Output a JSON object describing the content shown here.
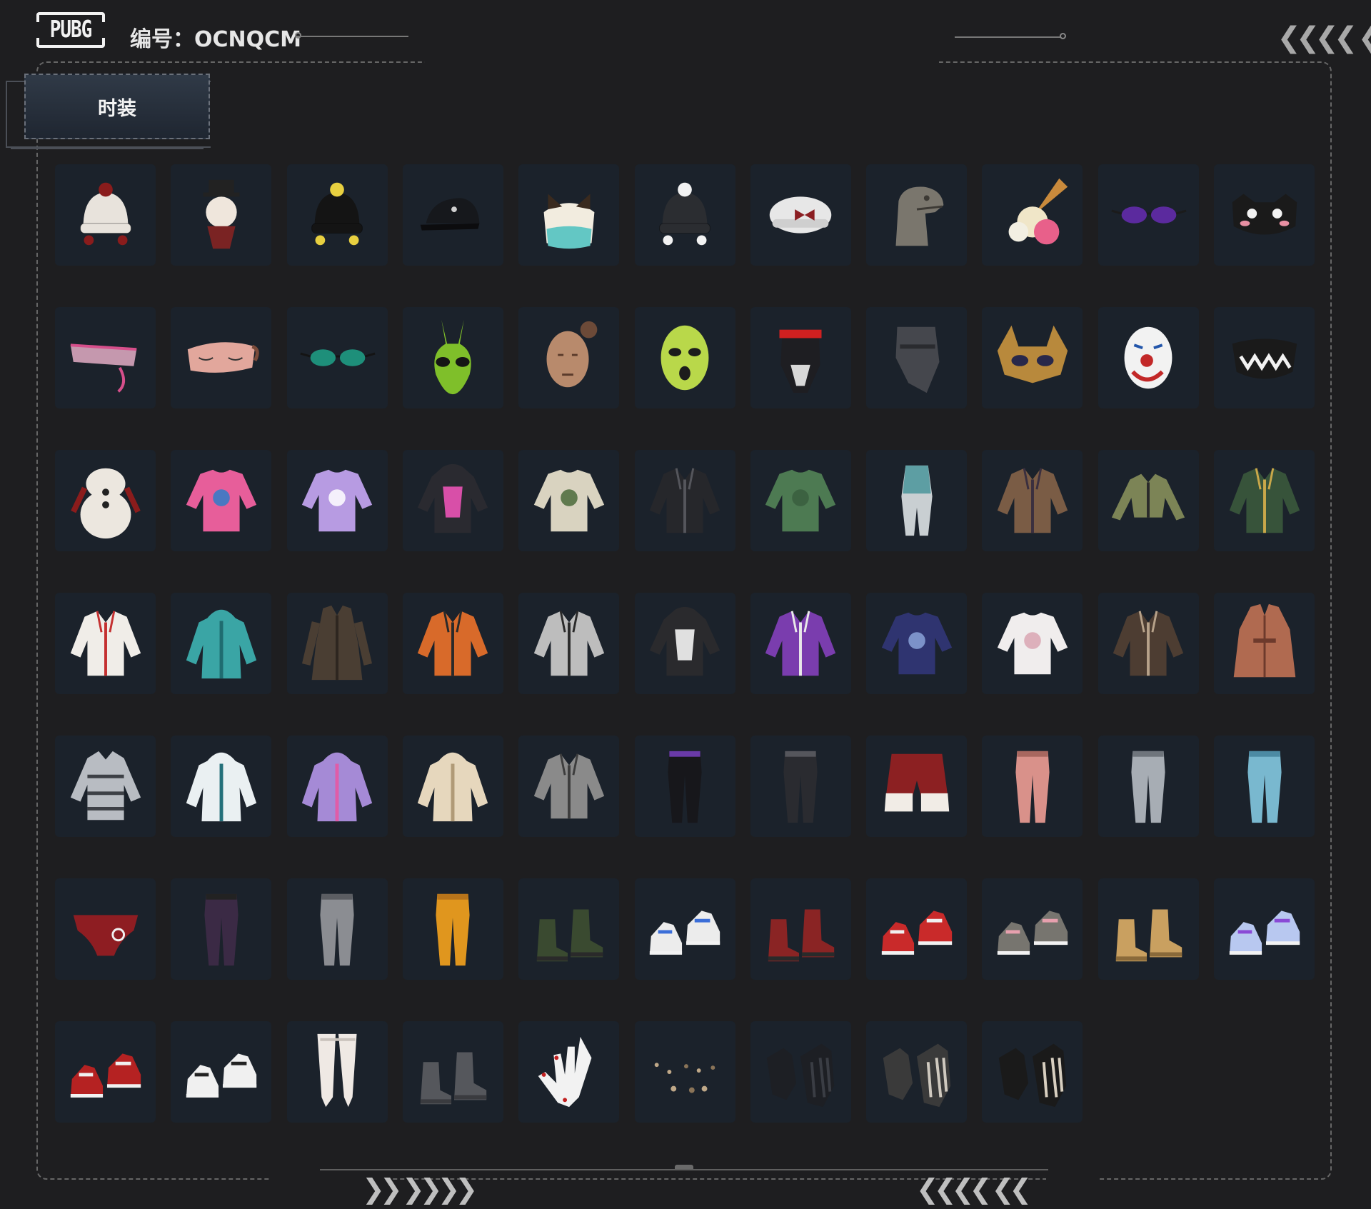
{
  "header": {
    "logo_text": "PUBG",
    "id_label": "编号：OCNQCM"
  },
  "tab": {
    "label": "时装"
  },
  "decorations": {
    "chevrons_top_right": "❮❮❮❮ ❮",
    "chevrons_bottom_left": "❯❯ ❯❯❯❯",
    "chevrons_bottom_right": "❮❮❮❮ ❮❮"
  },
  "items": [
    {
      "name": "snowball-knit-hat",
      "icon": "hat",
      "c1": "#e8e3dc",
      "c2": "#8a1c1c"
    },
    {
      "name": "snowman-head-hat",
      "icon": "snowman",
      "c1": "#efe6dc",
      "c2": "#7a2323"
    },
    {
      "name": "black-cat-beanie",
      "icon": "hat",
      "c1": "#141414",
      "c2": "#e8d040"
    },
    {
      "name": "black-cap",
      "icon": "cap",
      "c1": "#16181c",
      "c2": "#cfcfcf"
    },
    {
      "name": "teal-fur-hat",
      "icon": "fur",
      "c1": "#63c7c4",
      "c2": "#f2ecdf"
    },
    {
      "name": "penguin-beanie",
      "icon": "hat",
      "c1": "#2b2d31",
      "c2": "#f2f2f2"
    },
    {
      "name": "white-beret-bow",
      "icon": "beret",
      "c1": "#e7e7e7",
      "c2": "#8b1e22"
    },
    {
      "name": "dinosaur-head",
      "icon": "dino",
      "c1": "#7a766d",
      "c2": "#3d3a35"
    },
    {
      "name": "ice-cream-hat",
      "icon": "icecream",
      "c1": "#c98a3c",
      "c2": "#e8608a"
    },
    {
      "name": "purple-glasses",
      "icon": "glasses",
      "c1": "#5b2a9e",
      "c2": "#1b1b1b"
    },
    {
      "name": "cat-face-mask",
      "icon": "mask",
      "c1": "#1a1a1a",
      "c2": "#e88fa2"
    },
    {
      "name": "neon-visor",
      "icon": "visor",
      "c1": "#d64f8b",
      "c2": "#f0b7cf"
    },
    {
      "name": "sleep-eye-mask",
      "icon": "eyemask",
      "c1": "#e2a79c",
      "c2": "#7a4b3a"
    },
    {
      "name": "green-sport-shades",
      "icon": "glasses",
      "c1": "#1e8f7a",
      "c2": "#141414"
    },
    {
      "name": "alien-mask",
      "icon": "alien",
      "c1": "#7fbf2a",
      "c2": "#151515"
    },
    {
      "name": "stocking-mask",
      "icon": "head",
      "c1": "#b88a6c",
      "c2": "#6c4a38"
    },
    {
      "name": "lime-balaclava",
      "icon": "balaclava",
      "c1": "#b9d84a",
      "c2": "#1c1c1c"
    },
    {
      "name": "cyber-helmet-mask",
      "icon": "cybermask",
      "c1": "#d8d8d8",
      "c2": "#d02020"
    },
    {
      "name": "dark-scarf-mask",
      "icon": "scarf",
      "c1": "#45474d",
      "c2": "#2a2b2f"
    },
    {
      "name": "ornate-eye-mask",
      "icon": "ornate",
      "c1": "#b8893c",
      "c2": "#28284a"
    },
    {
      "name": "clown-mask",
      "icon": "clown",
      "c1": "#f2f2f2",
      "c2": "#c22828"
    },
    {
      "name": "teeth-face-mask",
      "icon": "teethmask",
      "c1": "#1a1a1a",
      "c2": "#f2f2f2"
    },
    {
      "name": "snowman-body-suit",
      "icon": "snowsuit",
      "c1": "#ece7df",
      "c2": "#8b1c1c"
    },
    {
      "name": "pink-blue-sweatshirt",
      "icon": "shirt",
      "c1": "#e75e9a",
      "c2": "#2e7cc9"
    },
    {
      "name": "lavender-cat-tee",
      "icon": "shirt",
      "c1": "#b79be2",
      "c2": "#ffffff"
    },
    {
      "name": "graphic-hoodie",
      "icon": "hoodie",
      "c1": "#2a2a30",
      "c2": "#d84fa8"
    },
    {
      "name": "cream-green-shirt",
      "icon": "shirt",
      "c1": "#d9d3c0",
      "c2": "#4a6a3a"
    },
    {
      "name": "black-leather-jacket",
      "icon": "jacket",
      "c1": "#26272b",
      "c2": "#55565c"
    },
    {
      "name": "green-long-sleeve",
      "icon": "shirt",
      "c1": "#4d7a52",
      "c2": "#3a5e3e"
    },
    {
      "name": "teal-combat-suit",
      "icon": "suit",
      "c1": "#5d9ea3",
      "c2": "#c9cfd2"
    },
    {
      "name": "brown-vest-jacket",
      "icon": "jacket",
      "c1": "#7a5c45",
      "c2": "#3a2f3f"
    },
    {
      "name": "olive-crop-jacket",
      "icon": "crop",
      "c1": "#7c8456",
      "c2": "#2a2a2a"
    },
    {
      "name": "green-bomber",
      "icon": "jacket",
      "c1": "#37533a",
      "c2": "#c9a84a"
    },
    {
      "name": "festive-print-jacket",
      "icon": "jacket",
      "c1": "#f0ede8",
      "c2": "#c43030"
    },
    {
      "name": "teal-parka",
      "icon": "parka",
      "c1": "#3aa5a5",
      "c2": "#1f6c70"
    },
    {
      "name": "brown-trench-coat",
      "icon": "coat",
      "c1": "#4a3e33",
      "c2": "#2e2620"
    },
    {
      "name": "orange-tech-jacket",
      "icon": "jacket",
      "c1": "#d86a2a",
      "c2": "#2a2a2a"
    },
    {
      "name": "silver-jacket",
      "icon": "jacket",
      "c1": "#bdbdbd",
      "c2": "#2a2a2a"
    },
    {
      "name": "wild-cat-hoodie",
      "icon": "hoodie",
      "c1": "#2a2a2d",
      "c2": "#e0e0e0"
    },
    {
      "name": "purple-track-jacket",
      "icon": "jacket",
      "c1": "#7a3dae",
      "c2": "#e9e9e9"
    },
    {
      "name": "navy-sash-sweater",
      "icon": "shirt",
      "c1": "#2f3470",
      "c2": "#8aa3d8"
    },
    {
      "name": "white-knit-sweater",
      "icon": "shirt",
      "c1": "#f0eded",
      "c2": "#d9a5b2"
    },
    {
      "name": "fur-leather-jacket",
      "icon": "jacket",
      "c1": "#4d3d32",
      "c2": "#b7a28a"
    },
    {
      "name": "copper-robe",
      "icon": "robe",
      "c1": "#b06a50",
      "c2": "#6d3a2c"
    },
    {
      "name": "grey-puffer",
      "icon": "puffer",
      "c1": "#b8bcc2",
      "c2": "#3d4046"
    },
    {
      "name": "white-hooded-coat",
      "icon": "parka",
      "c1": "#eaf0f2",
      "c2": "#24707a"
    },
    {
      "name": "purple-plush-hoodie",
      "icon": "parka",
      "c1": "#a58ad6",
      "c2": "#e05ca8"
    },
    {
      "name": "teddy-bear-coat",
      "icon": "parka",
      "c1": "#e6d7bd",
      "c2": "#b09a77"
    },
    {
      "name": "grey-tunic-jacket",
      "icon": "jacket",
      "c1": "#8a8a8a",
      "c2": "#3d3d3d"
    },
    {
      "name": "black-purple-pants",
      "icon": "pants",
      "c1": "#17171b",
      "c2": "#6a3aa8"
    },
    {
      "name": "black-leather-pants",
      "icon": "pants",
      "c1": "#2a2b30",
      "c2": "#55565c"
    },
    {
      "name": "red-fur-shorts",
      "icon": "shorts",
      "c1": "#8c2022",
      "c2": "#f1ece6"
    },
    {
      "name": "rose-gold-pants",
      "icon": "pants",
      "c1": "#d9918a",
      "c2": "#a8675f"
    },
    {
      "name": "grey-camo-pants",
      "icon": "pants",
      "c1": "#a7adb4",
      "c2": "#6f757c"
    },
    {
      "name": "light-blue-jeans",
      "icon": "pants",
      "c1": "#79b8cf",
      "c2": "#4c8aa3"
    },
    {
      "name": "red-briefs",
      "icon": "briefs",
      "c1": "#8e1d22",
      "c2": "#f0f0f0"
    },
    {
      "name": "purple-tactical-pants",
      "icon": "pants",
      "c1": "#3b2a45",
      "c2": "#222"
    },
    {
      "name": "grey-joggers",
      "icon": "pants",
      "c1": "#8b8d92",
      "c2": "#5b5d62"
    },
    {
      "name": "orange-pants",
      "icon": "pants",
      "c1": "#e0961e",
      "c2": "#b8741a"
    },
    {
      "name": "green-boots",
      "icon": "boots",
      "c1": "#3a4a30",
      "c2": "#2a2a2a"
    },
    {
      "name": "white-blue-sneakers",
      "icon": "sneakers",
      "c1": "#ececec",
      "c2": "#3b6ed8"
    },
    {
      "name": "red-wrap-boots",
      "icon": "boots",
      "c1": "#8a2424",
      "c2": "#2a2a2a"
    },
    {
      "name": "red-high-tops",
      "icon": "sneakers",
      "c1": "#c92a2a",
      "c2": "#f0f0f0"
    },
    {
      "name": "bunny-slippers",
      "icon": "sneakers",
      "c1": "#77756f",
      "c2": "#e7a0ae"
    },
    {
      "name": "tan-work-boots",
      "icon": "boots",
      "c1": "#c9a060",
      "c2": "#8a6a3a"
    },
    {
      "name": "holo-high-tops",
      "icon": "sneakers",
      "c1": "#b8c8f0",
      "c2": "#8a4ad6"
    },
    {
      "name": "red-sneakers",
      "icon": "sneakers",
      "c1": "#b52222",
      "c2": "#f0f0f0"
    },
    {
      "name": "white-black-sneakers",
      "icon": "sneakers",
      "c1": "#f0f0f0",
      "c2": "#222222"
    },
    {
      "name": "white-stockings",
      "icon": "legs",
      "c1": "#efe9e4",
      "c2": "#c9c2bb"
    },
    {
      "name": "grey-short-boots",
      "icon": "boots",
      "c1": "#55575c",
      "c2": "#3a3b3f"
    },
    {
      "name": "red-nail-hand",
      "icon": "hand",
      "c1": "#f2f2f2",
      "c2": "#c11f1f"
    },
    {
      "name": "piercing-set",
      "icon": "dots",
      "c1": "#bfa888",
      "c2": "#8a7458"
    },
    {
      "name": "black-gloves",
      "icon": "gloves",
      "c1": "#1d1f24",
      "c2": "#3a3d44"
    },
    {
      "name": "armored-gloves",
      "icon": "gloves",
      "c1": "#3a3a3a",
      "c2": "#cfc9bf"
    },
    {
      "name": "skeleton-gloves",
      "icon": "gloves",
      "c1": "#1a1a1a",
      "c2": "#d8cfc0"
    }
  ]
}
